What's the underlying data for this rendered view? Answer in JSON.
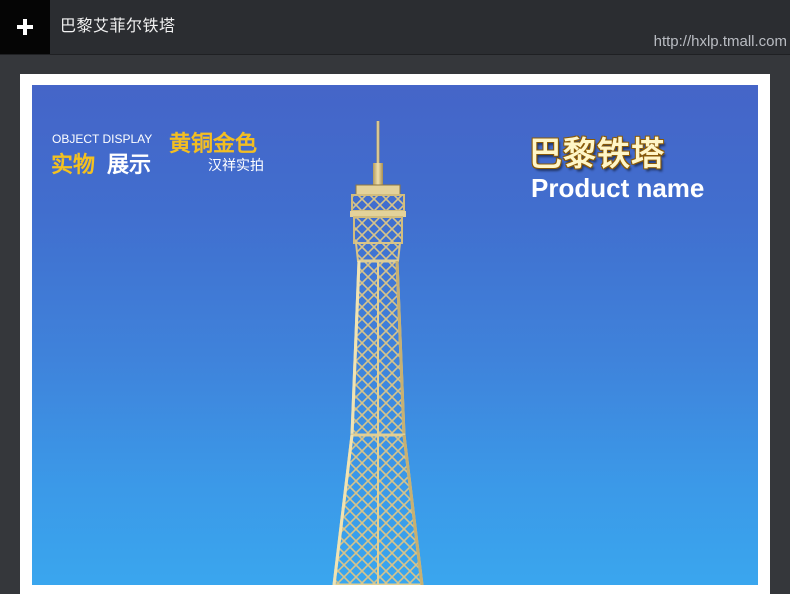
{
  "window": {
    "title": "巴黎艾菲尔铁塔",
    "url": "http://hxlp.tmall.com",
    "add_icon": "plus-icon"
  },
  "banner": {
    "object_display_en": "OBJECT DISPLAY",
    "object_display_cn_highlight": "实物",
    "object_display_cn_rest": "展示",
    "material": "黄铜金色",
    "real_photo": "汉祥实拍",
    "product_name_cn": "巴黎铁塔",
    "product_name_en": "Product name"
  },
  "colors": {
    "topbar": "#2b2d31",
    "accent_gold": "#f4c11f",
    "sky_top": "#4565c8",
    "sky_bottom": "#3aa6ee"
  }
}
